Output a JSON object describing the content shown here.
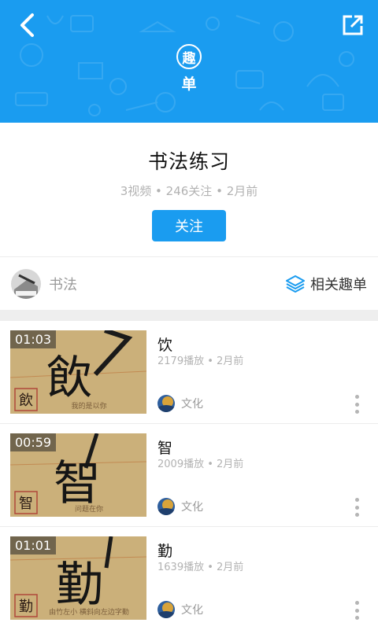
{
  "header": {
    "badge_top": "趣",
    "badge_bottom": "单",
    "back_icon": "chevron-left-icon",
    "share_icon": "share-external-icon",
    "bg_color": "#1a9cf0"
  },
  "playlist": {
    "title": "书法练习",
    "meta": "3视频 • 246关注 • 2月前",
    "follow_label": "关注"
  },
  "tag_row": {
    "tag_label": "书法",
    "related_label": "相关趣单",
    "related_icon": "layers-icon"
  },
  "videos": [
    {
      "duration": "01:03",
      "title": "饮",
      "meta": "2179播放 • 2月前",
      "author": "文化",
      "glyph": "飲",
      "caption": "我的是以你"
    },
    {
      "duration": "00:59",
      "title": "智",
      "meta": "2009播放 • 2月前",
      "author": "文化",
      "glyph": "智",
      "caption": "问题在你"
    },
    {
      "duration": "01:01",
      "title": "勤",
      "meta": "1639播放 • 2月前",
      "author": "文化",
      "glyph": "勤",
      "caption": "由竹左小 横斜向左边字勤"
    }
  ]
}
